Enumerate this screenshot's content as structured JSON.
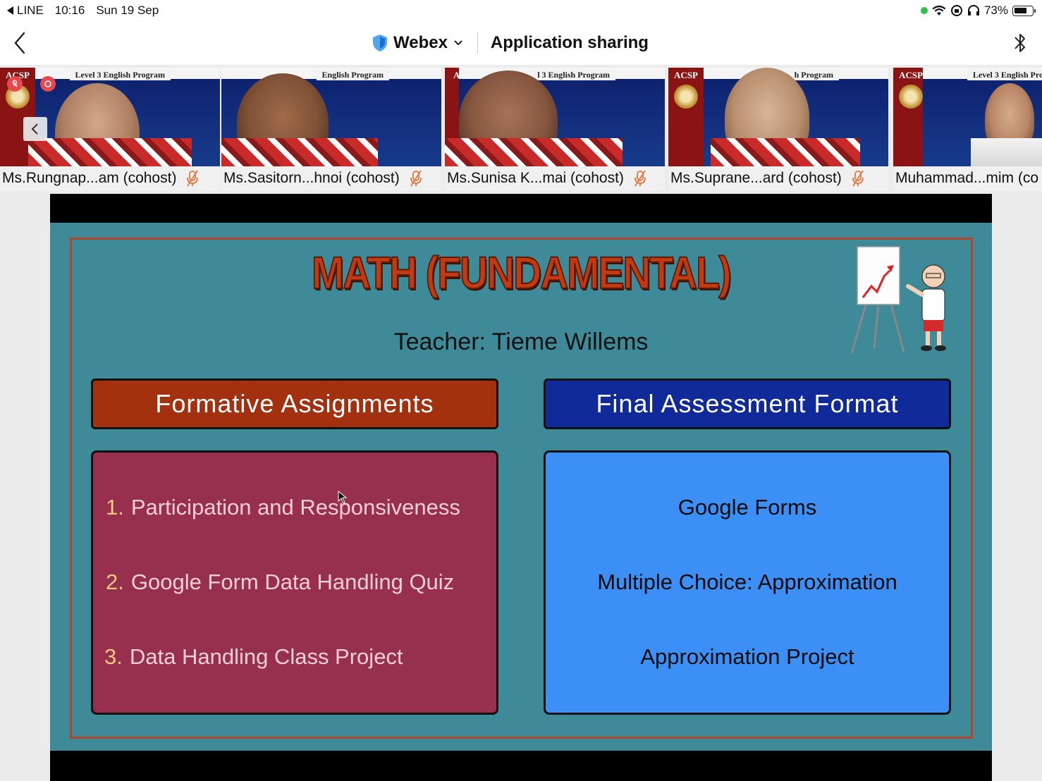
{
  "status_bar": {
    "back_app": "LINE",
    "time": "10:16",
    "date": "Sun 19 Sep",
    "battery": "73%",
    "battery_level": 0.73
  },
  "nav": {
    "app_name": "Webex",
    "title": "Application sharing"
  },
  "participants": [
    {
      "name": "Ms.Rungnap...am (cohost)",
      "banner": "Level 3 English Program",
      "logo": "ACSP",
      "muted": true
    },
    {
      "name": "Ms.Sasitorn...hnoi (cohost)",
      "banner": "English Program",
      "logo": "",
      "muted": true
    },
    {
      "name": "Ms.Sunisa K...mai (cohost)",
      "banner": "l 3 English Program",
      "logo": "A",
      "muted": true
    },
    {
      "name": "Ms.Suprane...ard (cohost)",
      "banner": "h Program",
      "logo": "ACSP",
      "muted": true
    },
    {
      "name": "Muhammad...mim (co",
      "banner": "Level 3 English Pro",
      "logo": "ACSP",
      "muted": false
    }
  ],
  "slide": {
    "title": "MATH (FUNDAMENTAL)",
    "teacher": "Teacher: Tieme Willems",
    "left_header": "Formative Assignments",
    "right_header": "Final Assessment Format",
    "left_items": [
      {
        "num": "1.",
        "text": "Participation and Responsiveness"
      },
      {
        "num": "2.",
        "text": "Google Form Data Handling Quiz"
      },
      {
        "num": "3.",
        "text": "Data Handling Class Project"
      }
    ],
    "right_items": [
      "Google Forms",
      "Multiple Choice: Approximation",
      "Approximation Project"
    ]
  },
  "colors": {
    "slide_bg": "#3e8a98",
    "title_red": "#c13a12",
    "left_header_bg": "#a3310f",
    "right_header_bg": "#112a9a",
    "left_box_bg": "#97304f",
    "right_box_bg": "#3b8ff5",
    "mic_muted": "#e8763c"
  },
  "icons": {
    "status_back": "back-triangle-icon",
    "nav_back": "chevron-left-icon",
    "webex_logo": "shield-icon",
    "dropdown": "chevron-down-icon",
    "bluetooth": "bluetooth-icon",
    "muted": "mic-off-icon",
    "strip_prev": "chevron-left-icon"
  }
}
